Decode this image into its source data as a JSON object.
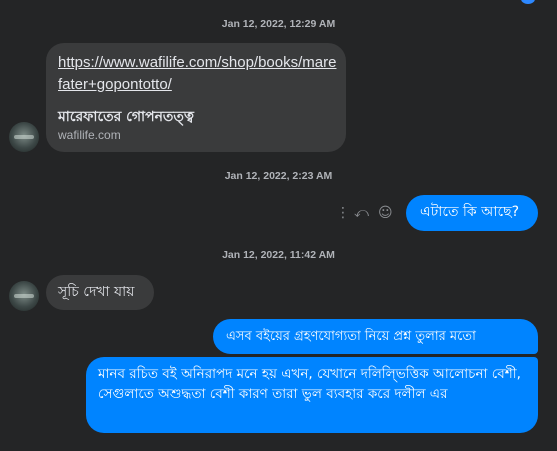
{
  "thread": {
    "timestamps": [
      "Jan 12, 2022, 12:29 AM",
      "Jan 12, 2022, 2:23 AM",
      "Jan 12, 2022, 11:42 AM"
    ],
    "link_preview": {
      "url": "https://www.wafilife.com/shop/books/marefater+gopontotto/",
      "title": "মারেফাতের গোপনতত্ত্ব",
      "domain": "wafilife.com"
    },
    "messages": [
      {
        "from": "me",
        "text": "এটাতে কি আছে?"
      },
      {
        "from": "them",
        "text": "সূচি দেখা যায়"
      },
      {
        "from": "me",
        "text": "এসব বইয়ের গ্রহণযোগ্যতা নিয়ে প্রশ্ন তুলার মতো"
      },
      {
        "from": "me",
        "text": "মানব রচিত বই অনিরাপদ মনে হয় এখন, যেখানে দলিল্ভিত্তিক আলোচনা বেশী, সেগুলাতে অশুদ্ধতা বেশী কারণ তারা ভুল ব্যবহার করে দলীল এর"
      }
    ],
    "message_actions": {
      "more_icon": "⋮",
      "reply_icon": "⤺",
      "react_icon": "☺"
    }
  }
}
